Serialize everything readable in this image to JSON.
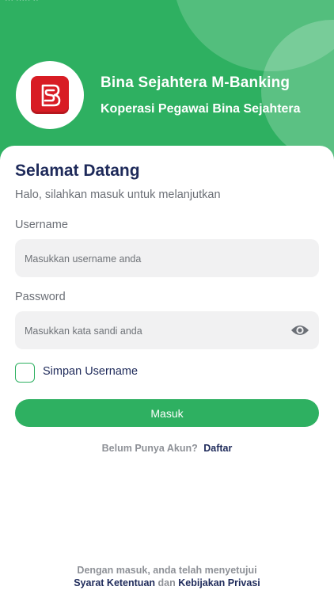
{
  "header": {
    "app_title": "Bina Sejahtera M-Banking",
    "app_subtitle": "Koperasi Pegawai Bina Sejahtera",
    "status_text": "··· ····· ··",
    "brand_color": "#2eb061",
    "logo_color": "#d81c24"
  },
  "login": {
    "title": "Selamat Datang",
    "subtitle": "Halo, silahkan masuk untuk melanjutkan",
    "username_label": "Username",
    "username_placeholder": "Masukkan username anda",
    "password_label": "Password",
    "password_placeholder": "Masukkan kata sandi anda",
    "remember_label": "Simpan Username",
    "remember_checked": false,
    "submit_label": "Masuk",
    "register_question": "Belum Punya Akun?",
    "register_link": "Daftar"
  },
  "footer": {
    "agree_text": "Dengan masuk, anda telah menyetujui",
    "terms_link": "Syarat Ketentuan",
    "and_text": "dan",
    "privacy_link": "Kebijakan Privasi"
  }
}
